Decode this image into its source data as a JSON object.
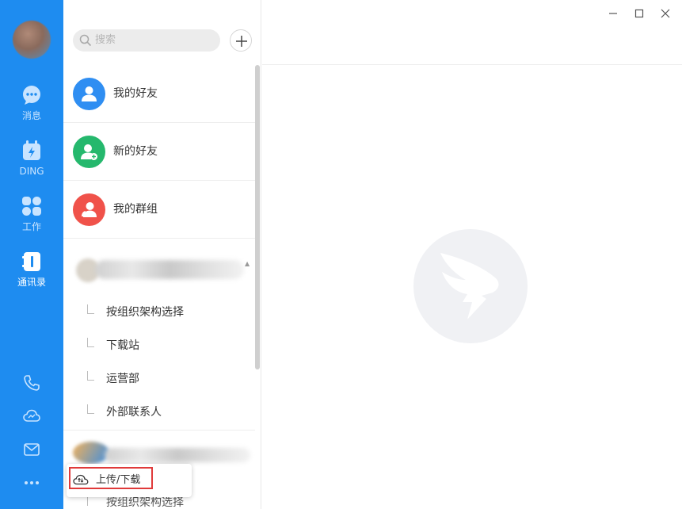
{
  "nav": {
    "items": [
      {
        "label": "消息",
        "icon": "chat-bubble-icon"
      },
      {
        "label": "DING",
        "icon": "ding-calendar-icon"
      },
      {
        "label": "工作",
        "icon": "apps-grid-icon"
      },
      {
        "label": "通讯录",
        "icon": "contacts-book-icon",
        "active": true
      }
    ],
    "bottom_icons": [
      "phone-icon",
      "cloud-icon",
      "mail-icon",
      "more-icon"
    ],
    "accent": "#1e8cf0"
  },
  "search": {
    "placeholder": "搜索"
  },
  "contacts": {
    "rows": [
      {
        "label": "我的好友",
        "color": "#2f8ef2"
      },
      {
        "label": "新的好友",
        "color": "#25b86d"
      },
      {
        "label": "我的群组",
        "color": "#f0524a"
      }
    ],
    "org_subitems": [
      "按组织架构选择",
      "下载站",
      "运营部",
      "外部联系人"
    ],
    "cut_item": "按组织架构选择"
  },
  "popup": {
    "label": "上传/下载",
    "highlight_color": "#e03a3a"
  }
}
